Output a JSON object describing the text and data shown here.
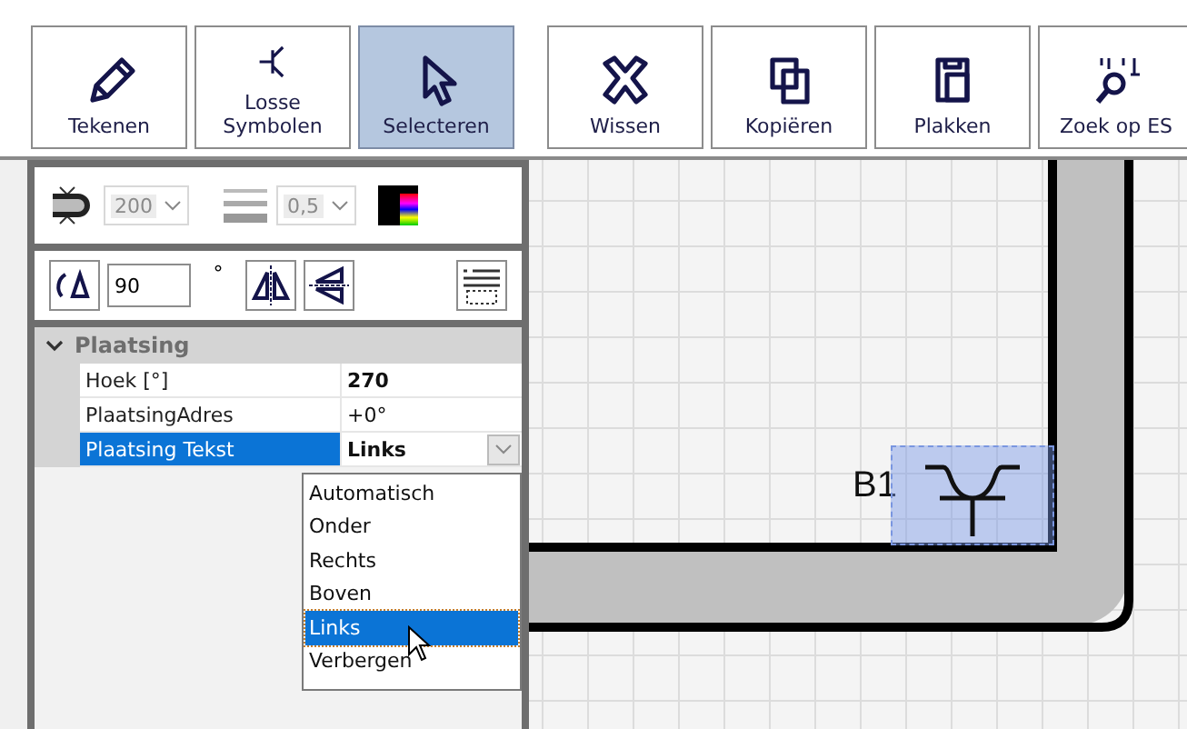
{
  "toolbar": {
    "groups": [
      [
        {
          "kind": "pencil",
          "label": "Tekenen",
          "selected": false
        },
        {
          "kind": "symbol",
          "label": "Losse\nSymbolen",
          "selected": false
        },
        {
          "kind": "cursor",
          "label": "Selecteren",
          "selected": true
        }
      ],
      [
        {
          "kind": "cross",
          "label": "Wissen",
          "selected": false
        },
        {
          "kind": "copy",
          "label": "Kopiëren",
          "selected": false
        },
        {
          "kind": "paste",
          "label": "Plakken",
          "selected": false
        },
        {
          "kind": "search",
          "label": "Zoek op ES",
          "selected": false
        }
      ]
    ]
  },
  "style_bar": {
    "size_select": {
      "value": "200",
      "disabled": true
    },
    "line_select": {
      "value": "0,5",
      "disabled": true
    }
  },
  "rotate_bar": {
    "angle": "90",
    "unit": "°"
  },
  "properties": {
    "category": {
      "label": "Plaatsing",
      "expanded": true
    },
    "rows": [
      {
        "label": "Hoek [°]",
        "value": "270",
        "modified": true,
        "selected": false,
        "dropdown": false
      },
      {
        "label": "PlaatsingAdres",
        "value": "+0°",
        "modified": false,
        "selected": false,
        "dropdown": false
      },
      {
        "label": "Plaatsing Tekst",
        "value": "Links",
        "modified": true,
        "selected": true,
        "dropdown": true
      }
    ]
  },
  "dropdown_list": [
    {
      "label": "Automatisch",
      "selected": false
    },
    {
      "label": "Onder",
      "selected": false
    },
    {
      "label": "Rechts",
      "selected": false
    },
    {
      "label": "Boven",
      "selected": false
    },
    {
      "label": "Links",
      "selected": true
    },
    {
      "label": "Verbergen",
      "selected": false
    }
  ],
  "canvas": {
    "symbol_label": "B1",
    "symbol_selected": true
  }
}
